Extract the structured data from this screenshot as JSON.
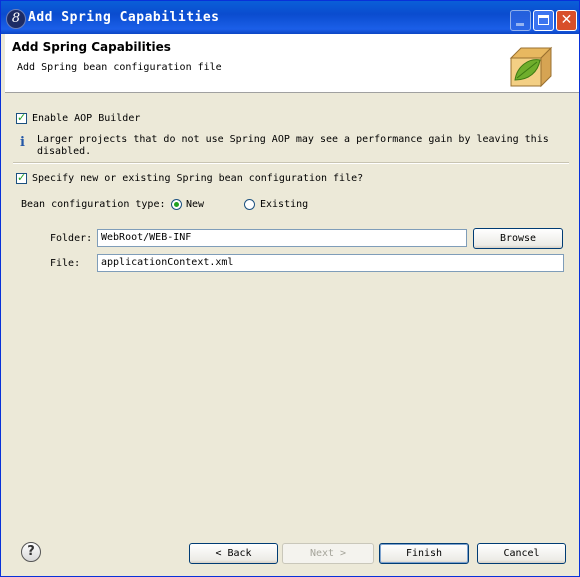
{
  "window": {
    "title": "Add Spring Capabilities",
    "title_icon": "eclipse-icon",
    "controls": {
      "minimize": "minimize-icon",
      "maximize": "maximize-icon",
      "close": "close-icon",
      "close_glyph": "✕"
    }
  },
  "banner": {
    "title": "Add Spring Capabilities",
    "description": "Add Spring bean configuration file",
    "image": "spring-leaf-box-icon"
  },
  "aop": {
    "checked": true,
    "label": "Enable AOP Builder",
    "info_icon": "info-icon",
    "info_glyph": "i",
    "info_text": "Larger projects that do not use Spring AOP may see a performance gain by leaving this disabled."
  },
  "config_file": {
    "checked": true,
    "label": "Specify new or existing Spring bean configuration file?",
    "type_label": "Bean configuration type:",
    "type_options": [
      {
        "label": "New",
        "selected": true
      },
      {
        "label": "Existing",
        "selected": false
      }
    ],
    "folder_label": "Folder:",
    "folder_value": "WebRoot/WEB-INF",
    "browse_label": "Browse",
    "file_label": "File:",
    "file_value": "applicationContext.xml"
  },
  "footer": {
    "help_glyph": "?",
    "back_label": "< Back",
    "next_label": "Next >",
    "finish_label": "Finish",
    "cancel_label": "Cancel"
  },
  "colors": {
    "title_bar": "#0a5fd8",
    "check_mark": "#21a121",
    "dialog_bg": "#ece9d8"
  }
}
